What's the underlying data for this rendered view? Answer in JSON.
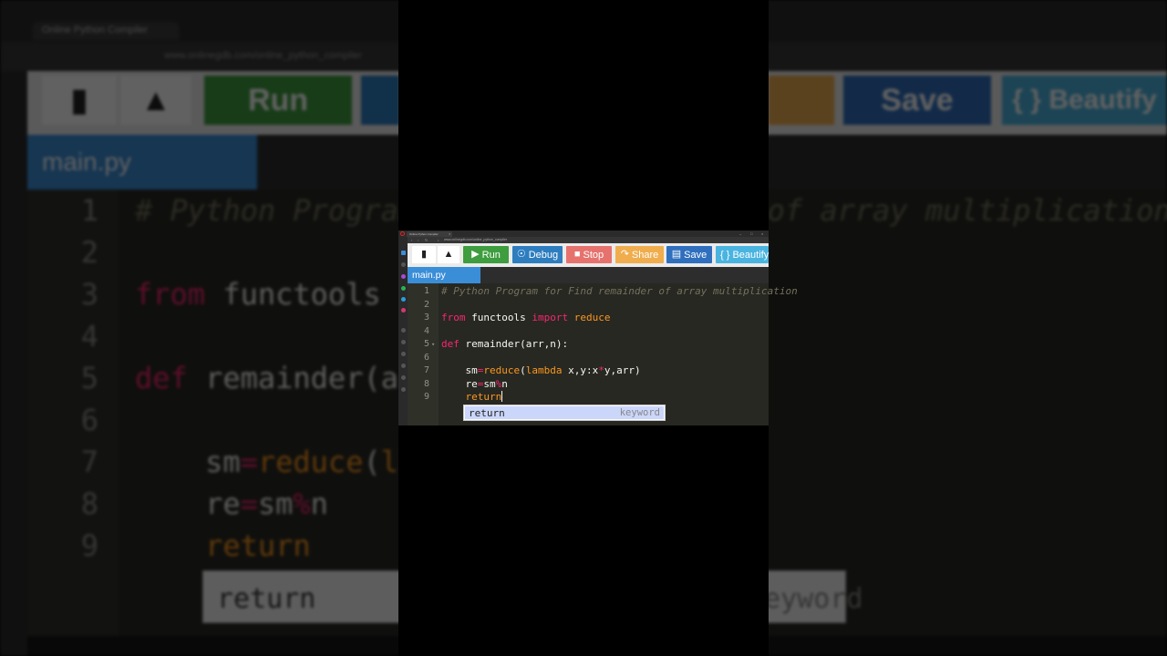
{
  "browser": {
    "tab_title": "Online Python Compiler",
    "url": "www.onlinegdb.com/online_python_compiler"
  },
  "toolbar": {
    "new_file_icon": "file-icon",
    "upload_icon": "cloud-upload-icon",
    "run": "Run",
    "debug": "Debug",
    "stop": "Stop",
    "share": "Share",
    "save": "Save",
    "beautify": "{ } Beautify",
    "colors": {
      "run": "#3e9d3e",
      "debug": "#2e7dbf",
      "stop": "#e6726e",
      "share": "#f0ad4e",
      "save": "#2f6fbe",
      "beautify": "#4ab4e0"
    }
  },
  "file_tab": "main.py",
  "editor": {
    "lines": [
      {
        "n": "1",
        "fold": "",
        "parts": [
          {
            "t": "# Python Program for Find remainder of array multiplication",
            "c": "c-comment"
          }
        ]
      },
      {
        "n": "2",
        "fold": "",
        "parts": []
      },
      {
        "n": "3",
        "fold": "",
        "parts": [
          {
            "t": "from",
            "c": "c-kw"
          },
          {
            "t": " functools ",
            "c": "c-plain"
          },
          {
            "t": "import",
            "c": "c-kw"
          },
          {
            "t": " reduce",
            "c": "c-builtin"
          }
        ]
      },
      {
        "n": "4",
        "fold": "",
        "parts": []
      },
      {
        "n": "5",
        "fold": "▾",
        "parts": [
          {
            "t": "def",
            "c": "c-kw"
          },
          {
            "t": " remainder(arr,n):",
            "c": "c-plain"
          }
        ]
      },
      {
        "n": "6",
        "fold": "",
        "parts": []
      },
      {
        "n": "7",
        "fold": "",
        "parts": [
          {
            "t": "    sm",
            "c": "c-plain"
          },
          {
            "t": "=",
            "c": "c-kw"
          },
          {
            "t": "reduce",
            "c": "c-builtin"
          },
          {
            "t": "(",
            "c": "c-plain"
          },
          {
            "t": "lambda",
            "c": "c-builtin"
          },
          {
            "t": " x,y:x",
            "c": "c-plain"
          },
          {
            "t": "*",
            "c": "c-kw"
          },
          {
            "t": "y,arr)",
            "c": "c-plain"
          }
        ]
      },
      {
        "n": "8",
        "fold": "",
        "parts": [
          {
            "t": "    re",
            "c": "c-plain"
          },
          {
            "t": "=",
            "c": "c-kw"
          },
          {
            "t": "sm",
            "c": "c-plain"
          },
          {
            "t": "%",
            "c": "c-kw"
          },
          {
            "t": "n",
            "c": "c-plain"
          }
        ]
      },
      {
        "n": "9",
        "fold": "",
        "parts": [
          {
            "t": "    ",
            "c": "c-plain"
          },
          {
            "t": "return",
            "c": "c-builtin"
          }
        ]
      }
    ]
  },
  "autocomplete": {
    "word": "return",
    "kind": "keyword"
  }
}
